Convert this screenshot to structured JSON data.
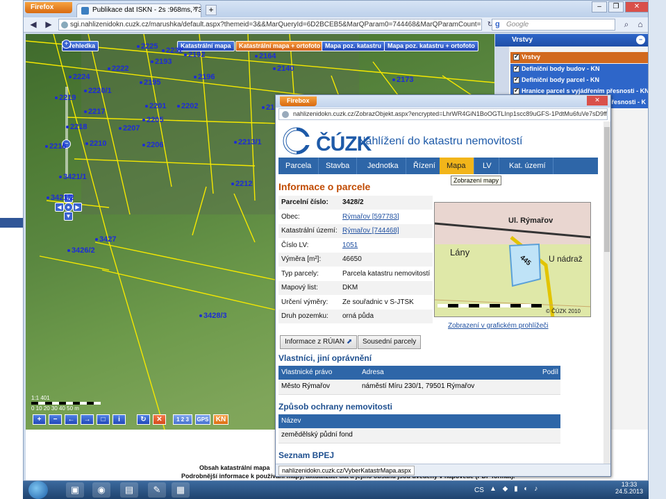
{
  "browser": {
    "menu_button": "Firefox",
    "tab_title": "Publikace dat ISKN - 2s :968ms, 731 prvků.",
    "new_tab": "+",
    "url": "sgi.nahlizenidokn.cuzk.cz/marushka/default.aspx?themeid=3&&MarQueryId=6D2BCEB5&MarQParam0=744468&MarQParamCount=1&MarWindowName",
    "search_engine": "Google",
    "search_placeholder": "Google"
  },
  "map": {
    "buttons": [
      "Přehledka",
      "Katastrální mapa",
      "Katastrální mapa + ortofoto",
      "Mapa poz. katastru",
      "Mapa poz. katastru + ortofoto"
    ],
    "active_button_index": 2,
    "parcel_labels": [
      {
        "text": "2225"
      },
      {
        "text": "2232"
      },
      {
        "text": "2192"
      },
      {
        "text": "2193"
      },
      {
        "text": "2164"
      },
      {
        "text": "2224"
      },
      {
        "text": "2222"
      },
      {
        "text": "2195"
      },
      {
        "text": "2196"
      },
      {
        "text": "2219"
      },
      {
        "text": "2220/1"
      },
      {
        "text": "2201"
      },
      {
        "text": "2202"
      },
      {
        "text": "2217"
      },
      {
        "text": "2207"
      },
      {
        "text": "2205"
      },
      {
        "text": "2206"
      },
      {
        "text": "2218"
      },
      {
        "text": "2210"
      },
      {
        "text": "2212"
      },
      {
        "text": "2173"
      },
      {
        "text": "3421/1"
      },
      {
        "text": "3421/2"
      },
      {
        "text": "3427"
      },
      {
        "text": "3426/2"
      },
      {
        "text": "3428/3"
      },
      {
        "text": "2140"
      },
      {
        "text": "2150"
      },
      {
        "text": "2213/1"
      },
      {
        "text": "2216"
      }
    ],
    "scale_label": "1:1 401",
    "scale_ticks": "0 10 20 30 40 50 m",
    "toolbar_buttons": [
      "+",
      "−",
      "←",
      "→",
      "□",
      "i",
      "↻",
      "✕",
      "1 2 3",
      "GPS",
      "KN"
    ],
    "footer_line1": "Obsah katastrální mapa",
    "footer_line2": "Podrobnější informace k používání mapy, aktualizaci dat a jejího obsahu jsou uvedeny v nápovědě (PDF formát)."
  },
  "layers": {
    "title": "Vrstvy",
    "side_label": "Vrstvy",
    "items": [
      {
        "label": "Vrstvy",
        "checked": true,
        "level": "main"
      },
      {
        "label": "Definiční body budov - KN",
        "checked": true,
        "level": "sub"
      },
      {
        "label": "Definiční body parcel - KN",
        "checked": true,
        "level": "sub"
      },
      {
        "label": "Hranice parcel s vyjádřením přesnosti - KN",
        "checked": true,
        "level": "sub"
      },
      {
        "label": "přesnosti - K",
        "checked": true,
        "level": "sub"
      }
    ]
  },
  "popup": {
    "menu_button": "Firebox",
    "url": "nahlizenidokn.cuzk.cz/ZobrazObjekt.aspx?encrypted=LhrWR4GiN1BoOGTLInp1scc89uGFS-1PdtMu6fuVe7sD9ff-R35u",
    "logo_text": "ČÚZK",
    "site_title": "Nahlížení do katastru nemovitostí",
    "menu": [
      "Parcela",
      "Stavba",
      "Jednotka",
      "Řízení",
      "Mapa",
      "LV",
      "Kat. území"
    ],
    "active_menu_index": 4,
    "tooltip": "Zobrazení mapy",
    "heading": "Informace o parcele",
    "parcel_info": [
      {
        "label": "Parcelní číslo:",
        "value": "3428/2",
        "link": false
      },
      {
        "label": "Obec:",
        "value": "Rýmařov [597783]",
        "link": true
      },
      {
        "label": "Katastrální území:",
        "value": "Rýmařov [744468]",
        "link": true
      },
      {
        "label": "Číslo LV:",
        "value": "1051",
        "link": true
      },
      {
        "label": "Výměra [m²]:",
        "value": "46650",
        "link": false
      },
      {
        "label": "Typ parcely:",
        "value": "Parcela katastru nemovitostí",
        "link": false
      },
      {
        "label": "Mapový list:",
        "value": "DKM",
        "link": false
      },
      {
        "label": "Určení výměry:",
        "value": "Ze souřadnic v S-JTSK",
        "link": false
      },
      {
        "label": "Druh pozemku:",
        "value": "orná půda",
        "link": false
      }
    ],
    "mini_map": {
      "labels": [
        "Ul. Rýmařov",
        "Lány",
        "U nádraž",
        "445",
        "© ČÚZK 2010"
      ]
    },
    "graphic_link": "Zobrazení v grafickém prohlížeči",
    "btn_ruian": "Informace z RÚIAN",
    "btn_neighbors": "Sousední parcely",
    "owners_heading": "Vlastníci, jiní oprávnění",
    "owners_columns": [
      "Vlastnické právo",
      "Adresa",
      "Podíl"
    ],
    "owners_rows": [
      {
        "name": "Město Rýmařov",
        "address": "náměstí Míru 230/1, 79501 Rýmařov",
        "share": ""
      }
    ],
    "protection_heading": "Způsob ochrany nemovitosti",
    "protection_columns": [
      "Název"
    ],
    "protection_rows": [
      "zemědělský půdní fond"
    ],
    "bpej_heading": "Seznam BPEJ",
    "status_url": "nahlizenidokn.cuzk.cz/VyberKatastrMapa.aspx"
  },
  "taskbar": {
    "language": "CS",
    "time": "13:33",
    "date": "24.5.2013"
  },
  "colors": {
    "accent_blue": "#2e66a8",
    "menu_active": "#f2b51a",
    "heading_orange": "#c04a00",
    "parcel_label_blue": "#1c2bd8",
    "parcel_line_yellow": "#f5e800"
  }
}
